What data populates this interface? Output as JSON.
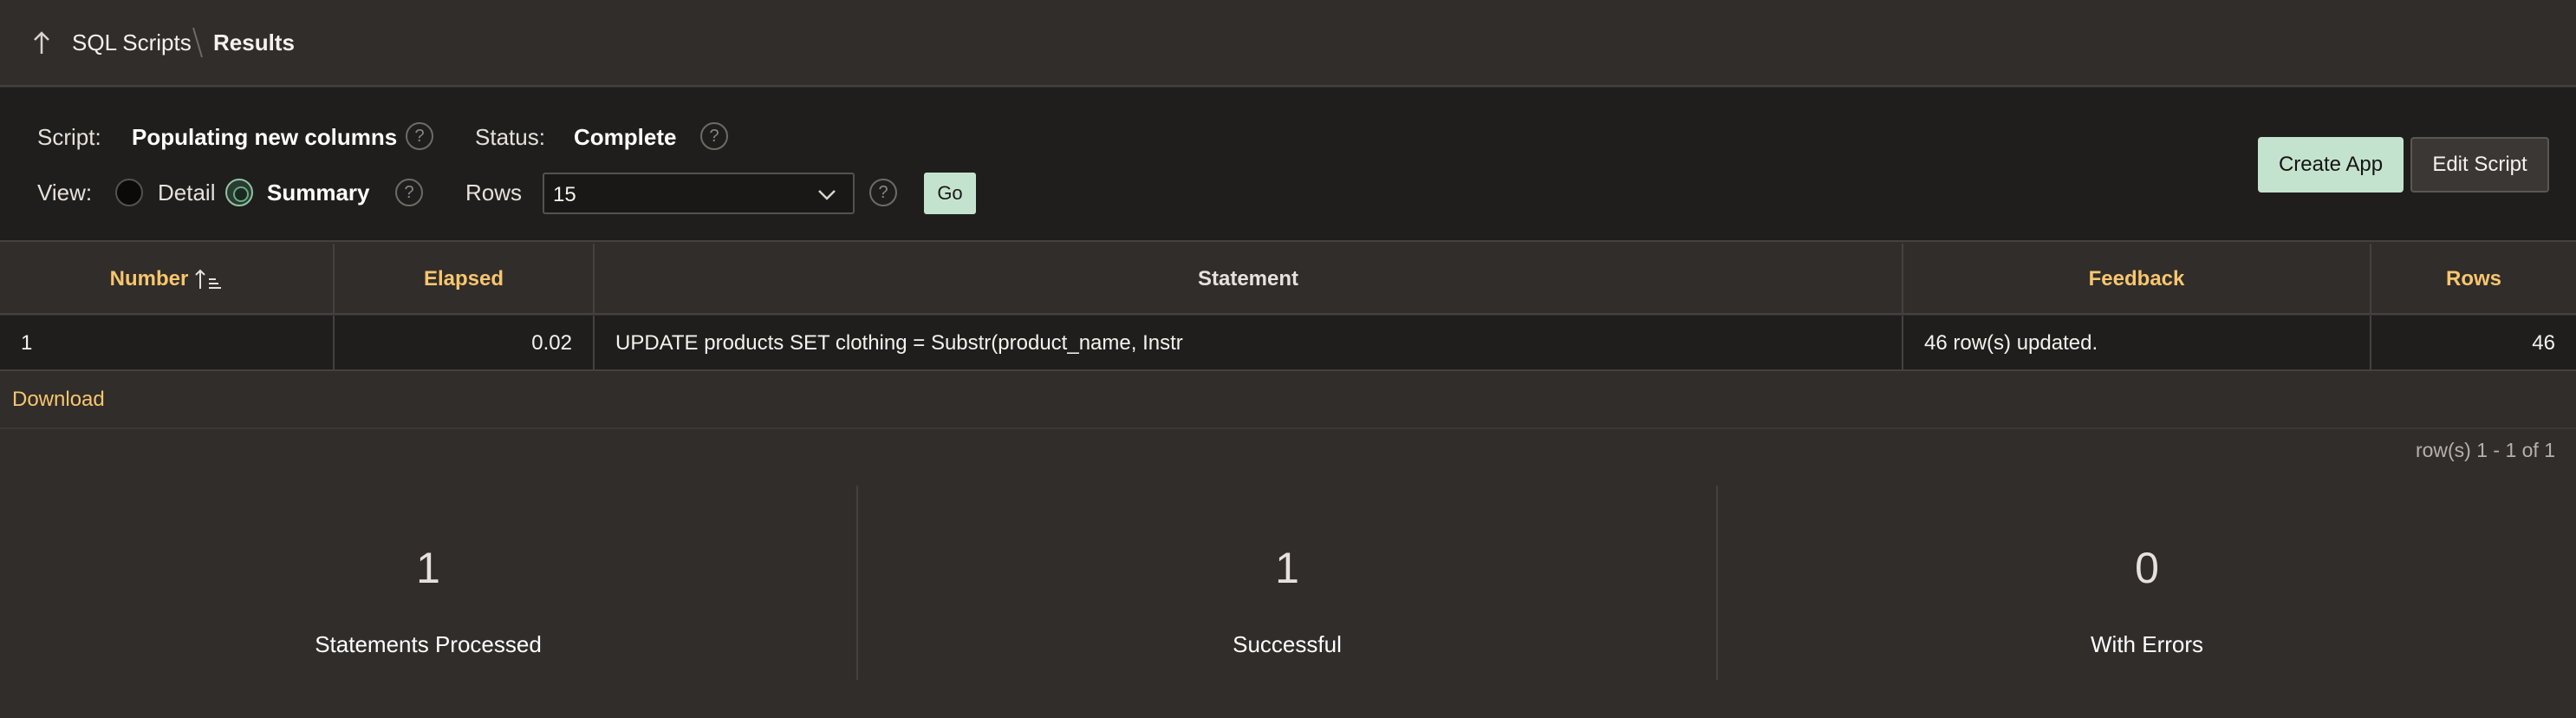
{
  "breadcrumb": {
    "items": [
      "SQL Scripts",
      "Results"
    ]
  },
  "script_info": {
    "script_label": "Script:",
    "script_name": "Populating new columns",
    "status_label": "Status:",
    "status_value": "Complete",
    "view_label": "View:",
    "view_options": [
      {
        "label": "Detail",
        "selected": false
      },
      {
        "label": "Summary",
        "selected": true
      }
    ],
    "rows_label": "Rows",
    "rows_value": "15",
    "go_label": "Go",
    "help_glyph": "?"
  },
  "actions": {
    "create_app": "Create App",
    "edit_script": "Edit Script"
  },
  "table": {
    "columns": [
      "Number",
      "Elapsed",
      "Statement",
      "Feedback",
      "Rows"
    ],
    "rows": [
      {
        "number": "1",
        "elapsed": "0.02",
        "statement": "UPDATE products SET clothing = Substr(product_name, Instr",
        "feedback": "46 row(s) updated.",
        "rows": "46"
      }
    ],
    "sorted_column": "Number",
    "sort_direction": "ascending"
  },
  "download_label": "Download",
  "pagination": "row(s) 1 - 1 of 1",
  "summary": [
    {
      "value": "1",
      "label": "Statements Processed"
    },
    {
      "value": "1",
      "label": "Successful"
    },
    {
      "value": "0",
      "label": "With Errors"
    }
  ],
  "colors": {
    "background": "#312d2a",
    "panel": "#201e1c",
    "accent_gold": "#f7c66f",
    "primary_button": "#c4e3cf"
  },
  "icons": {
    "up": "arrow-up-icon",
    "separator": "breadcrumb-separator",
    "sort": "sort-ascending-icon",
    "chevron": "chevron-down-icon",
    "help": "help-icon"
  }
}
